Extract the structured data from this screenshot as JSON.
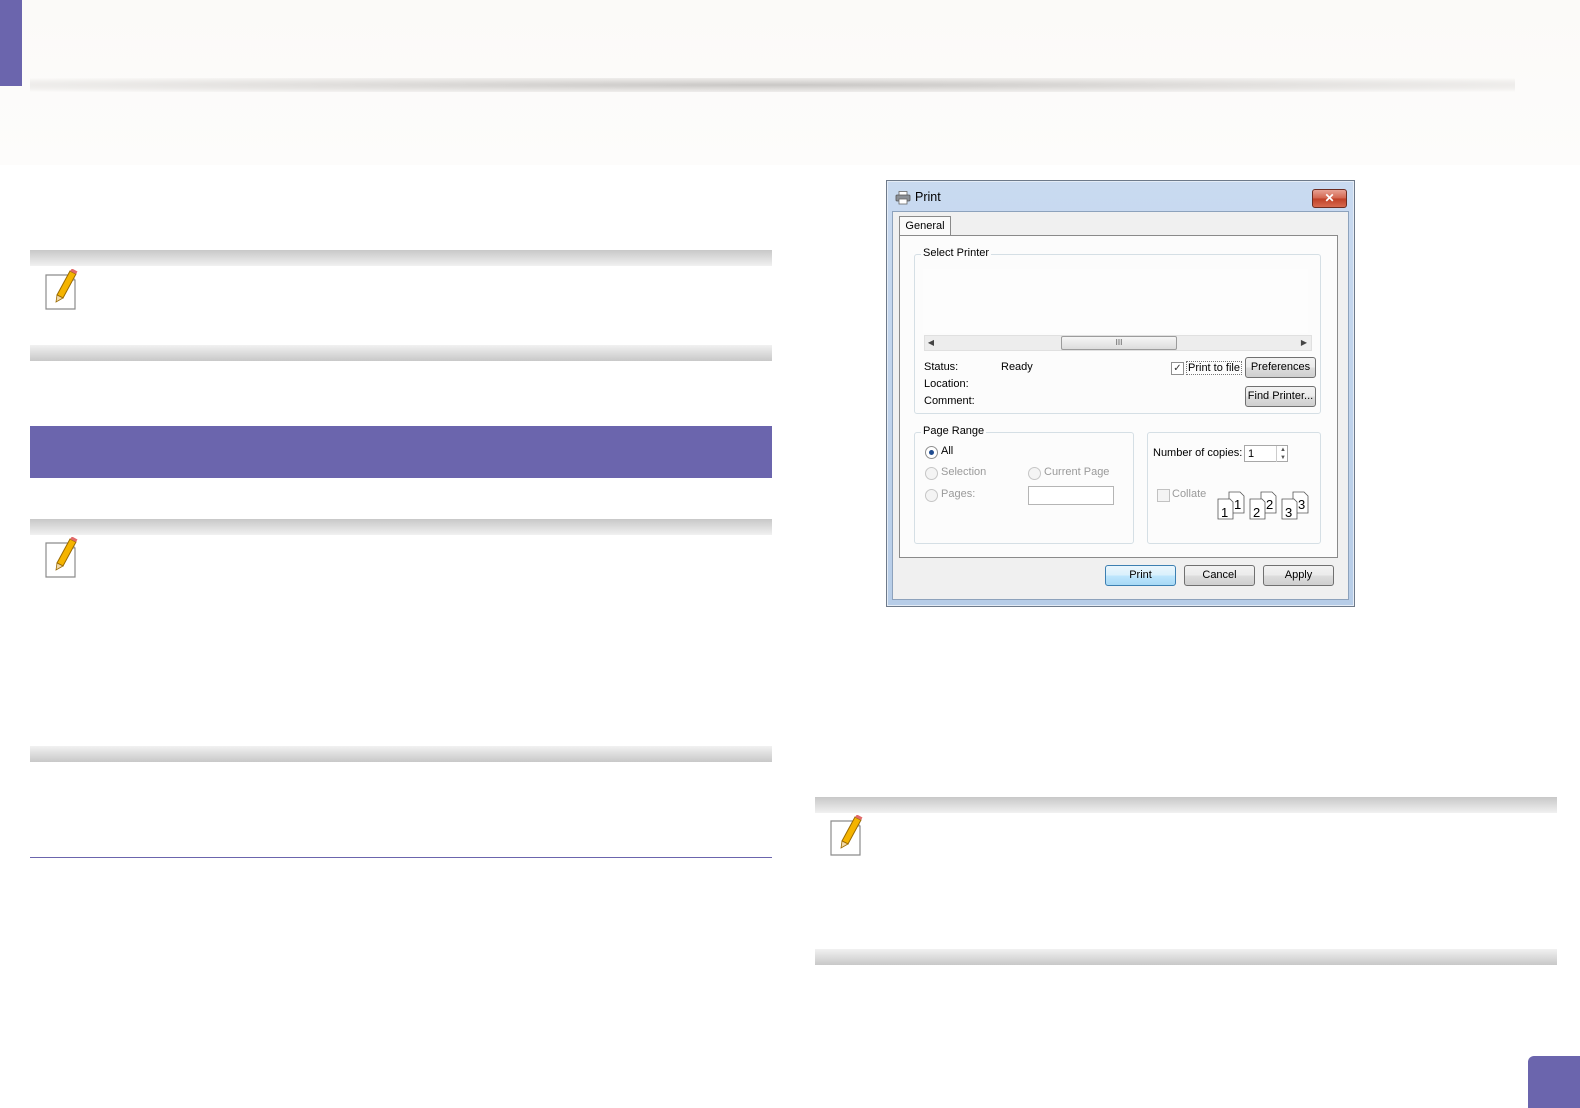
{
  "dialog": {
    "title": "Print",
    "close_label": "✕",
    "tab_general": "General",
    "select_printer_legend": "Select Printer",
    "scroll_thumb_grip": "III",
    "status_label": "Status:",
    "status_value": "Ready",
    "location_label": "Location:",
    "comment_label": "Comment:",
    "print_to_file_label": "Print to file",
    "print_to_file_checked": true,
    "preferences_button": "Preferences",
    "find_printer_button": "Find Printer...",
    "page_range_legend": "Page Range",
    "range_all": "All",
    "range_selection": "Selection",
    "range_current_page": "Current Page",
    "range_pages": "Pages:",
    "selected_range": "All",
    "copies_label": "Number of copies:",
    "copies_value": "1",
    "collate_label": "Collate",
    "collate_checked": false,
    "collate_pages": [
      "1",
      "1",
      "2",
      "2",
      "3",
      "3"
    ],
    "print_button": "Print",
    "cancel_button": "Cancel",
    "apply_button": "Apply"
  },
  "colors": {
    "accent": "#6b65ad",
    "note_bar_dark": "#c8c8c8",
    "note_bar_light": "#f1f1f1",
    "dialog_frame": "#b7cde8"
  },
  "icons": {
    "note": "note-pencil-icon",
    "printer": "printer-icon",
    "close": "close-icon"
  }
}
